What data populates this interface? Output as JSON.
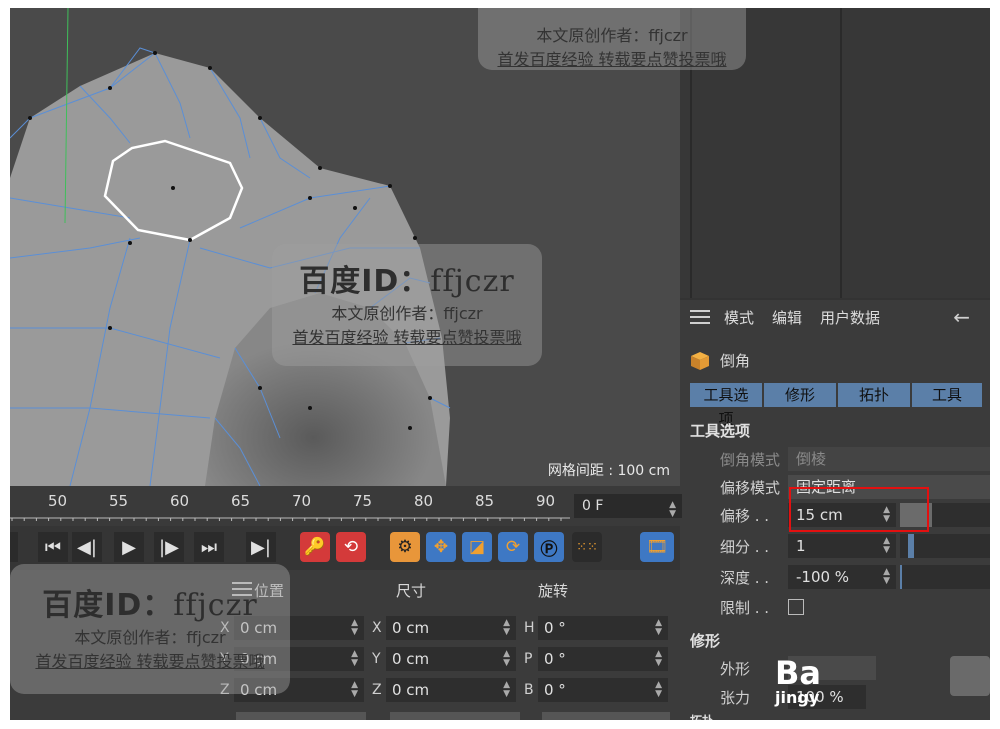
{
  "viewport": {
    "grid_readout": "网格间距 : 100 cm"
  },
  "attributes": {
    "menu": [
      "模式",
      "编辑",
      "用户数据"
    ],
    "back_arrow": "←",
    "object_name": "倒角",
    "tabs": [
      "工具选项",
      "修形",
      "拓扑",
      "工具"
    ],
    "section_tool": "工具选项",
    "bevel_mode_label": "倒角模式",
    "bevel_mode_value": "倒棱",
    "offset_mode_label": "偏移模式",
    "offset_mode_value": "固定距离",
    "offset_label": "偏移 . .",
    "offset_value": "15 cm",
    "offset_slider_fraction": 0.35,
    "subdiv_label": "细分 . .",
    "subdiv_value": "1",
    "depth_label": "深度 . .",
    "depth_value": "-100 %",
    "limit_label": "限制 . .",
    "section_shape": "修形",
    "shape_label": "外形",
    "tension_label": "张力",
    "tension_value": "100 %",
    "section_topo": "拓扑"
  },
  "timeline": {
    "ticks": [
      "50",
      "55",
      "60",
      "65",
      "70",
      "75",
      "80",
      "85",
      "90"
    ],
    "current_frame": "0 F"
  },
  "coordinates": {
    "headers": [
      "位置",
      "尺寸",
      "旋转"
    ],
    "position": [
      {
        "axis": "X",
        "value": "0 cm"
      },
      {
        "axis": "Y",
        "value": "0 cm"
      },
      {
        "axis": "Z",
        "value": "0 cm"
      }
    ],
    "size": [
      {
        "axis": "X",
        "value": "0 cm"
      },
      {
        "axis": "Y",
        "value": "0 cm"
      },
      {
        "axis": "Z",
        "value": "0 cm"
      }
    ],
    "rotation": [
      {
        "axis": "H",
        "value": "0 °"
      },
      {
        "axis": "P",
        "value": "0 °"
      },
      {
        "axis": "B",
        "value": "0 °"
      }
    ]
  },
  "watermark": {
    "title_a": "百度ID：",
    "title_b": "ffjczr",
    "line1": "本文原创作者：ffjczr",
    "line2": "首发百度经验  转载要点赞投票哦"
  },
  "logo_text": "jingy"
}
